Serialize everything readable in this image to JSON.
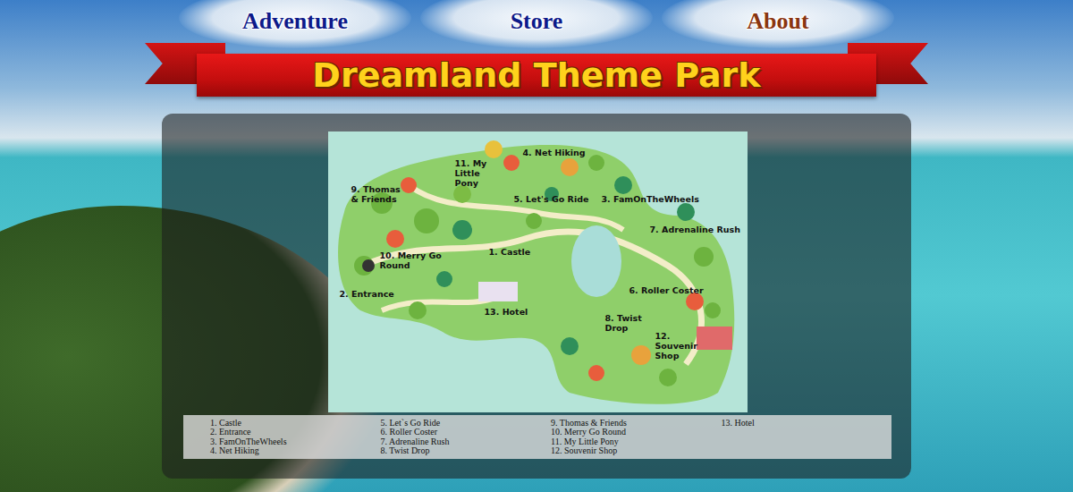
{
  "nav": [
    {
      "label": "Adventure",
      "selected": false
    },
    {
      "label": "Store",
      "selected": false
    },
    {
      "label": "About",
      "selected": true
    }
  ],
  "banner": {
    "title": "Dreamland Theme Park"
  },
  "map": {
    "labels": [
      "4. Net Hiking",
      "11. My Little Pony",
      "9. Thomas & Friends",
      "5. Let's Go Ride",
      "3. FamOnTheWheels",
      "7. Adrenaline Rush",
      "10. Merry Go Round",
      "1. Castle",
      "2. Entrance",
      "6. Roller Coster",
      "13. Hotel",
      "8. Twist Drop",
      "12. Souvenir Shop"
    ]
  },
  "legend": [
    "1. Castle",
    "2. Entrance",
    "3. FamOnTheWheels",
    "4. Net Hiking",
    "5. Let`s Go Ride",
    "6. Roller Coster",
    "7. Adrenaline Rush",
    "8. Twist Drop",
    "9. Thomas & Friends",
    "10. Merry Go Round",
    "11. My Little Pony",
    "12. Souvenir Shop",
    "13. Hotel"
  ]
}
